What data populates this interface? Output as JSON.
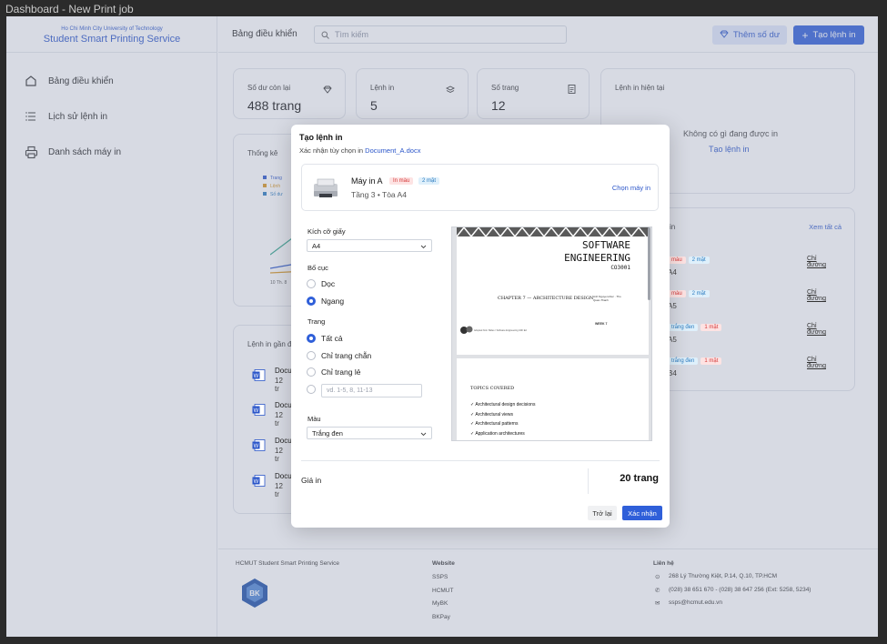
{
  "window": {
    "title": "Dashboard - New Print job"
  },
  "brand": {
    "university": "Ho Chi Minh City University of Technology",
    "service": "Student Smart Printing Service"
  },
  "sidebar": {
    "items": [
      {
        "label": "Bảng điều khiển",
        "icon": "home-icon"
      },
      {
        "label": "Lịch sử lệnh in",
        "icon": "list-icon"
      },
      {
        "label": "Danh sách máy in",
        "icon": "printer-icon"
      }
    ]
  },
  "topbar": {
    "breadcrumb": "Bảng điều khiển",
    "search_placeholder": "Tìm kiếm",
    "add_balance_label": "Thêm số dư",
    "new_job_label": "Tạo lệnh in"
  },
  "stats": [
    {
      "label": "Số dư còn lại",
      "value": "488 trang",
      "icon": "diamond-icon"
    },
    {
      "label": "Lệnh in",
      "value": "5",
      "icon": "layers-icon"
    },
    {
      "label": "Số trang",
      "value": "12",
      "icon": "document-icon"
    }
  ],
  "current_job": {
    "title": "Lệnh in hiện tại",
    "empty_text": "Không có gì đang được in",
    "create_link": "Tạo lệnh in"
  },
  "stats_panel": {
    "title": "Thống kê",
    "legend": [
      "Trang",
      "Lệnh",
      "Số dư"
    ],
    "x_tick": "10 Th. 8"
  },
  "recent_jobs": {
    "title": "Lệnh in gần đ",
    "items": [
      {
        "name": "Docu",
        "meta": "12 tr"
      },
      {
        "name": "Docu",
        "meta": "12 tr"
      },
      {
        "name": "Docu",
        "meta": "12 tr"
      },
      {
        "name": "Docu",
        "meta": "12 tr"
      }
    ]
  },
  "printers_panel": {
    "title": "in",
    "view_all": "Xem tất cả",
    "rows": [
      {
        "tag1": "màu",
        "tag2": "2 mặt",
        "size": "A4",
        "action": "Chỉ đường"
      },
      {
        "tag1": "màu",
        "tag2": "2 mặt",
        "size": "A5",
        "action": "Chỉ đường"
      },
      {
        "tag1": "trắng đen",
        "tag2": "1 mặt",
        "size": "A5",
        "action": "Chỉ đường"
      },
      {
        "tag1": "trắng đen",
        "tag2": "1 mặt",
        "size": "B4",
        "action": "Chỉ đường"
      }
    ]
  },
  "footer": {
    "brand": "HCMUT Student Smart Printing Service",
    "website_title": "Website",
    "links": [
      "SSPS",
      "HCMUT",
      "MyBK",
      "BKPay"
    ],
    "contact_title": "Liên hệ",
    "address": "268 Lý Thường Kiệt, P.14, Q.10, TP.HCM",
    "phone": "(028) 38 651 670 - (028) 38 647 256 (Ext: 5258, 5234)",
    "email": "ssps@hcmut.edu.vn",
    "logo_text": "BK"
  },
  "modal": {
    "title": "Tạo lệnh in",
    "subtitle_prefix": "Xác nhận tùy chọn in",
    "file_name": "Document_A.docx",
    "printer": {
      "name": "Máy in A",
      "tag_color": "In màu",
      "tag_sides": "2 mặt",
      "location": "Tầng 3 • Tòa A4",
      "choose_label": "Chọn máy in"
    },
    "paper_size": {
      "label": "Kích cỡ giấy",
      "value": "A4"
    },
    "layout": {
      "label": "Bố cục",
      "options": [
        "Dọc",
        "Ngang"
      ],
      "selected": "Ngang"
    },
    "pages": {
      "label": "Trang",
      "options": [
        "Tất cả",
        "Chỉ trang chẵn",
        "Chỉ trang lẻ"
      ],
      "selected": "Tất cả",
      "custom_placeholder": "vd. 1-5, 8, 11-13"
    },
    "color": {
      "label": "Màu",
      "value": "Trắng đen"
    },
    "preview": {
      "title_line1": "SOFTWARE",
      "title_line2": "ENGINEERING",
      "course_code": "CO3001",
      "chapter": "CHAPTER 7 — ARCHITECTURE DESIGN",
      "authors": "Anh Nguyen-Duc · Tho Quan-Thanh",
      "week": "WEEK 7",
      "source_note": "Adopted from Slides / Software Engineering 10th Ed",
      "topics_title": "TOPICS COVERED",
      "topics": [
        "Architectural design decisions",
        "Architectural views",
        "Architectural patterns",
        "Application architectures"
      ]
    },
    "price_label": "Giá in",
    "price_value": "20 trang",
    "back_label": "Trở lại",
    "confirm_label": "Xác nhận"
  }
}
